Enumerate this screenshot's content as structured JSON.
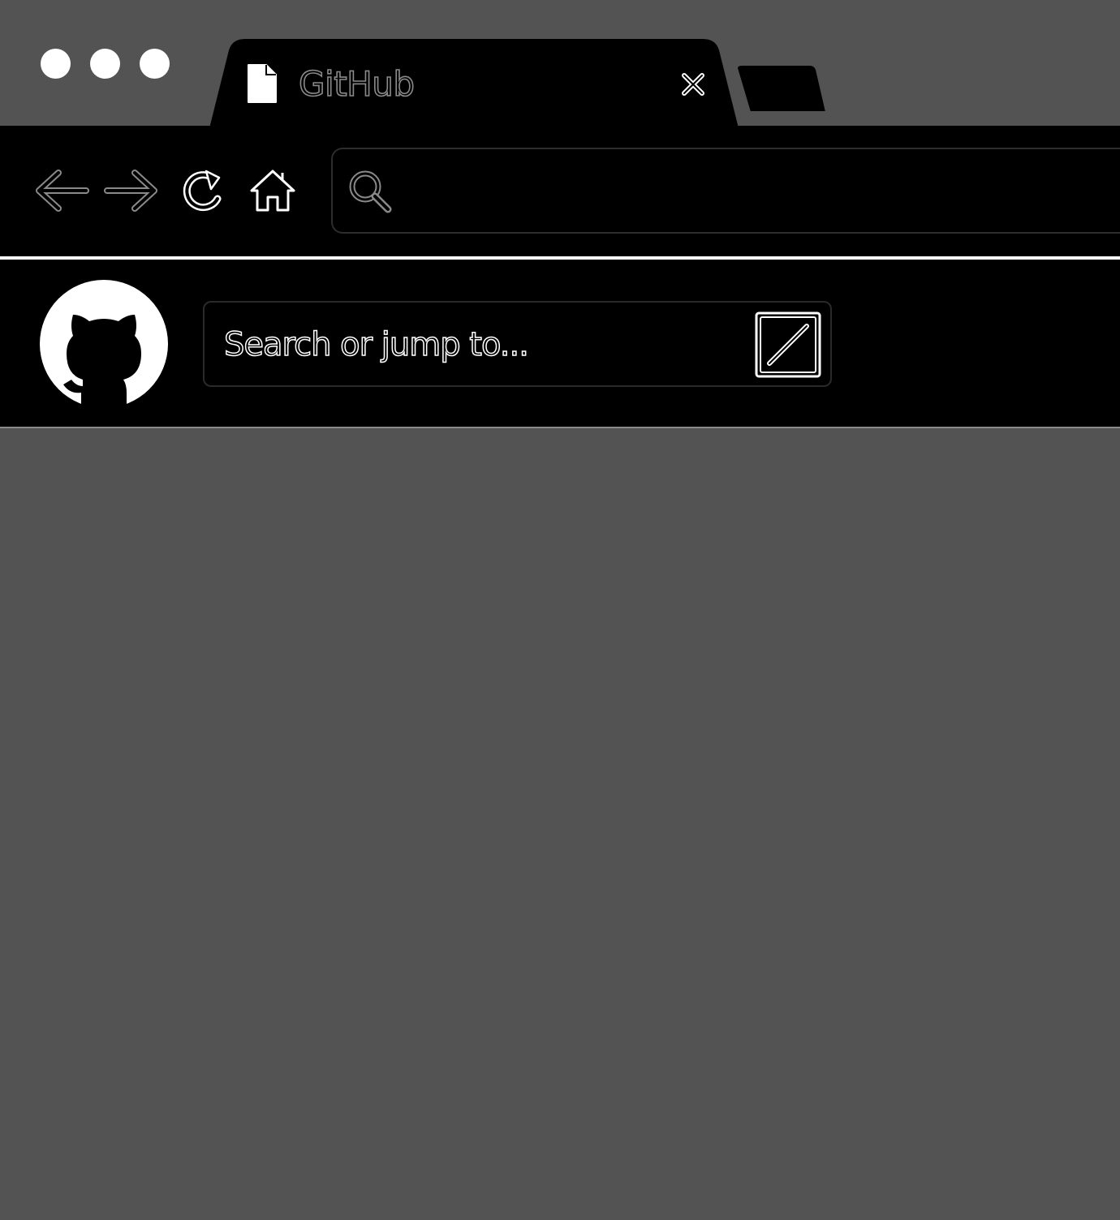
{
  "browser": {
    "tab": {
      "title": "GitHub"
    },
    "address_bar": {
      "value": ""
    }
  },
  "github_header": {
    "search": {
      "placeholder": "Search or jump to...",
      "shortcut_key": "/"
    }
  },
  "colors": {
    "window_background": "#535353",
    "chrome_background": "#000000",
    "foreground": "#ffffff",
    "tab_title_outline": "#8a8a8a"
  },
  "icons": {
    "window_controls": [
      "window-dot-icon",
      "window-dot-icon",
      "window-dot-icon"
    ],
    "tab": [
      "page-icon",
      "close-icon"
    ],
    "toolbar": [
      "back-arrow-icon",
      "forward-arrow-icon",
      "reload-icon",
      "home-icon",
      "search-icon"
    ],
    "header": [
      "github-logo-icon",
      "slash-key-icon"
    ]
  }
}
